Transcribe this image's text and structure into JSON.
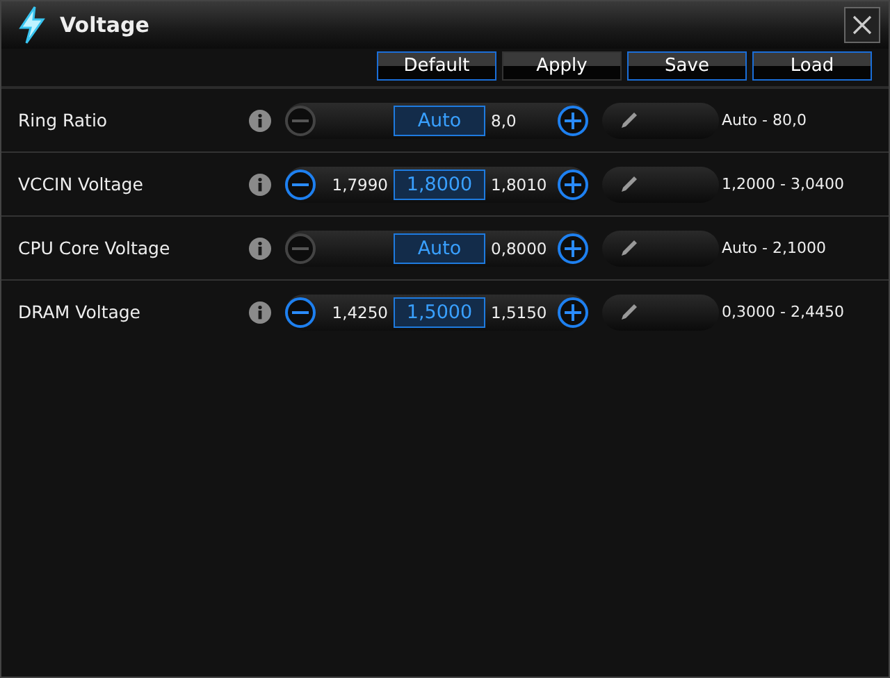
{
  "window": {
    "title": "Voltage"
  },
  "buttons": [
    {
      "label": "Default",
      "highlighted": true
    },
    {
      "label": "Apply",
      "highlighted": false
    },
    {
      "label": "Save",
      "highlighted": true
    },
    {
      "label": "Load",
      "highlighted": true
    }
  ],
  "settings": [
    {
      "label": "Ring Ratio",
      "minus_disabled": true,
      "value": "Auto",
      "next": "8,0",
      "range": "Auto - 80,0"
    },
    {
      "label": "VCCIN Voltage",
      "minus_disabled": false,
      "previous": "1,7990",
      "value": "1,8000",
      "next": "1,8010",
      "range": "1,2000 - 3,0400"
    },
    {
      "label": "CPU Core Voltage",
      "minus_disabled": true,
      "value": "Auto",
      "next": "0,8000",
      "range": "Auto - 2,1000"
    },
    {
      "label": "DRAM Voltage",
      "minus_disabled": false,
      "previous": "1,4250",
      "value": "1,5000",
      "next": "1,5150",
      "range": "0,3000 - 2,4450"
    }
  ]
}
